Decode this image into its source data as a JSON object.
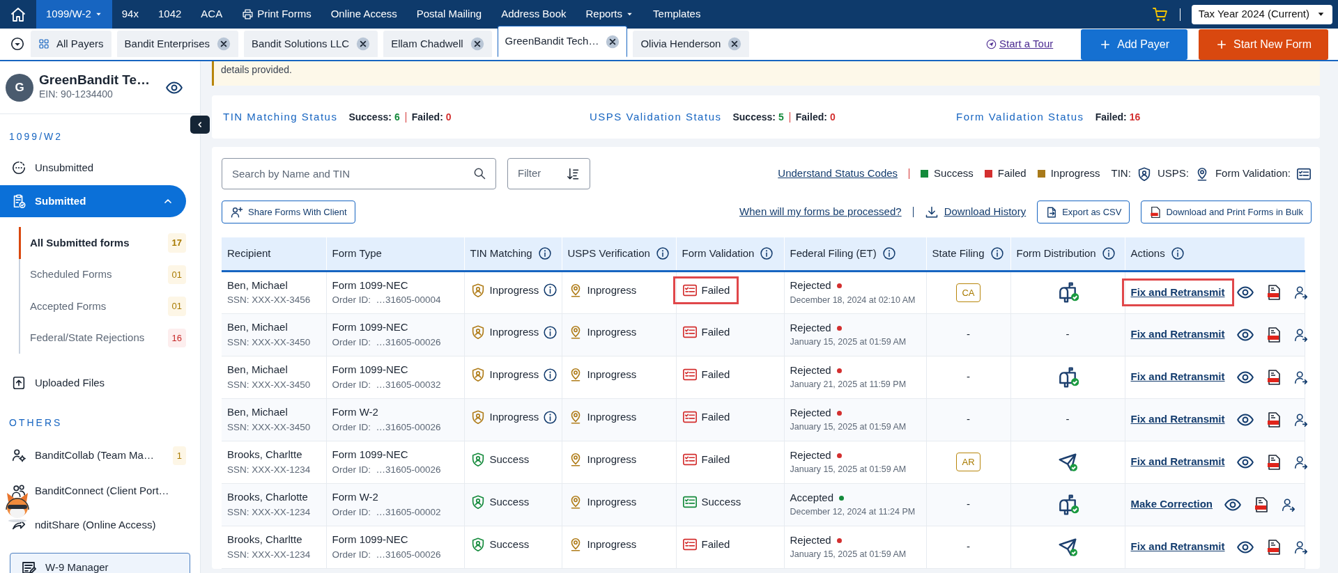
{
  "top_nav": {
    "items": [
      {
        "label": "1099/W-2",
        "selected": true,
        "kind": "dropdown"
      },
      {
        "label": "94x",
        "selected": false,
        "kind": "plain"
      },
      {
        "label": "1042",
        "selected": false,
        "kind": "plain"
      },
      {
        "label": "ACA",
        "selected": false,
        "kind": "plain"
      },
      {
        "label": "Print Forms",
        "selected": false,
        "kind": "print"
      },
      {
        "label": "Online Access",
        "selected": false,
        "kind": "plain"
      },
      {
        "label": "Postal Mailing",
        "selected": false,
        "kind": "plain"
      },
      {
        "label": "Address Book",
        "selected": false,
        "kind": "plain"
      },
      {
        "label": "Reports",
        "selected": false,
        "kind": "dropdown"
      },
      {
        "label": "Templates",
        "selected": false,
        "kind": "plain"
      }
    ],
    "tax_year": "Tax Year 2024 (Current)"
  },
  "payer_bar": {
    "all_label": "All Payers",
    "tabs": [
      {
        "label": "Bandit Enterprises",
        "selected": false
      },
      {
        "label": "Bandit Solutions LLC",
        "selected": false
      },
      {
        "label": "Ellam Chadwell",
        "selected": false
      },
      {
        "label": "GreenBandit Tech…",
        "selected": true
      },
      {
        "label": "Olivia Henderson",
        "selected": false
      }
    ],
    "tour_link": "Start a Tour",
    "add_payer": "Add Payer",
    "start_form": "Start New Form"
  },
  "sidebar": {
    "payer": {
      "initial": "G",
      "name": "GreenBandit Te…",
      "ein": "EIN: 90-1234400"
    },
    "sections": [
      {
        "title": "1099/W2",
        "items": [
          {
            "label": "Unsubmitted",
            "kind": "unsubmitted",
            "selected": false
          },
          {
            "label": "Submitted",
            "kind": "submitted",
            "selected": true,
            "expanded": true,
            "children": [
              {
                "label": "All Submitted forms",
                "count": "17",
                "color": "#a87a00",
                "selected": true
              },
              {
                "label": "Scheduled Forms",
                "count": "01",
                "color": "#a87a00",
                "selected": false
              },
              {
                "label": "Accepted Forms",
                "count": "01",
                "color": "#a87a00",
                "selected": false
              },
              {
                "label": "Federal/State Rejections",
                "count": "16",
                "color": "#c62828",
                "selected": false
              }
            ]
          },
          {
            "label": "Uploaded Files",
            "kind": "upload",
            "selected": false
          }
        ]
      },
      {
        "title": "OTHERS",
        "items": [
          {
            "label": "BanditCollab (Team Ma…",
            "kind": "team",
            "count": "1",
            "color": "#a87a00",
            "selected": false
          },
          {
            "label": "BanditConnect (Client Port…",
            "kind": "connect",
            "selected": false
          },
          {
            "label": "nditShare (Online Access)",
            "kind": "share",
            "selected": false
          }
        ]
      }
    ],
    "w9_button": "W-9 Manager"
  },
  "banner": {
    "text": "details provided."
  },
  "status_summary": [
    {
      "title": "TIN Matching Status",
      "parts": [
        {
          "label": "Success:",
          "value": "6",
          "kind": "success"
        },
        {
          "label": "Failed:",
          "value": "0",
          "kind": "failed"
        }
      ]
    },
    {
      "title": "USPS Validation Status",
      "parts": [
        {
          "label": "Success:",
          "value": "5",
          "kind": "success"
        },
        {
          "label": "Failed:",
          "value": "0",
          "kind": "failed"
        }
      ]
    },
    {
      "title": "Form Validation Status",
      "parts": [
        {
          "label": "Failed:",
          "value": "16",
          "kind": "failed"
        }
      ]
    }
  ],
  "toolbar": {
    "search": {
      "placeholder": "Search by Name and TIN"
    },
    "filter": "Filter",
    "status_codes_link": "Understand Status Codes",
    "legend": [
      {
        "label": "Success",
        "color": "#148a3b"
      },
      {
        "label": "Failed",
        "color": "#d32f2f"
      },
      {
        "label": "Inprogress",
        "color": "#a87a1a"
      }
    ],
    "legend_icons": [
      {
        "label": "TIN:",
        "kind": "tin"
      },
      {
        "label": "USPS:",
        "kind": "usps"
      },
      {
        "label": "Form Validation:",
        "kind": "validation"
      }
    ],
    "share_button": "Share Forms With Client",
    "processed_link": "When will my forms be processed?",
    "download_history": "Download History",
    "export_csv": "Export as CSV",
    "bulk_download": "Download and Print Forms in Bulk"
  },
  "table": {
    "columns": [
      {
        "label": "Recipient"
      },
      {
        "label": "Form Type"
      },
      {
        "label": "TIN Matching",
        "info": true
      },
      {
        "label": "USPS Verification",
        "info": true
      },
      {
        "label": "Form Validation",
        "info": true
      },
      {
        "label": "Federal Filing (ET)",
        "info": true
      },
      {
        "label": "State Filing",
        "info": true
      },
      {
        "label": "Form Distribution",
        "info": true
      },
      {
        "label": "Actions",
        "info": true
      }
    ],
    "rows": [
      {
        "recipient": "Ben, Michael",
        "ssn": "SSN: XXX-XX-3456",
        "form_type": "Form 1099-NEC",
        "order_id": "Order ID:  …31605-00004",
        "tin": {
          "status": "Inprogress",
          "kind": "inprogress",
          "info": true
        },
        "usps": {
          "status": "Inprogress",
          "kind": "inprogress"
        },
        "validation": {
          "status": "Failed",
          "kind": "failed",
          "highlighted": true
        },
        "federal": {
          "status": "Rejected",
          "color": "#d32f2f",
          "date": "December 18, 2024 at 02:10 AM"
        },
        "state": {
          "text": "CA",
          "kind": "badge"
        },
        "distribution": {
          "kind": "mail"
        },
        "action": {
          "label": "Fix and Retransmit",
          "highlighted": true
        }
      },
      {
        "recipient": "Ben, Michael",
        "ssn": "SSN: XXX-XX-3450",
        "form_type": "Form 1099-NEC",
        "order_id": "Order ID:  …31605-00026",
        "tin": {
          "status": "Inprogress",
          "kind": "inprogress",
          "info": true
        },
        "usps": {
          "status": "Inprogress",
          "kind": "inprogress"
        },
        "validation": {
          "status": "Failed",
          "kind": "failed"
        },
        "federal": {
          "status": "Rejected",
          "color": "#d32f2f",
          "date": "January 15, 2025 at 01:59 AM"
        },
        "state": {
          "text": "-",
          "kind": "none"
        },
        "distribution": {
          "kind": "none",
          "text": "-"
        },
        "action": {
          "label": "Fix and Retransmit"
        }
      },
      {
        "recipient": "Ben, Michael",
        "ssn": "SSN: XXX-XX-3450",
        "form_type": "Form 1099-NEC",
        "order_id": "Order ID:  …31605-00032",
        "tin": {
          "status": "Inprogress",
          "kind": "inprogress",
          "info": true
        },
        "usps": {
          "status": "Inprogress",
          "kind": "inprogress"
        },
        "validation": {
          "status": "Failed",
          "kind": "failed"
        },
        "federal": {
          "status": "Rejected",
          "color": "#d32f2f",
          "date": "January 21, 2025 at 11:59 PM"
        },
        "state": {
          "text": "-",
          "kind": "none"
        },
        "distribution": {
          "kind": "mail"
        },
        "action": {
          "label": "Fix and Retransmit"
        }
      },
      {
        "recipient": "Ben, Michael",
        "ssn": "SSN: XXX-XX-3450",
        "form_type": "Form W-2",
        "order_id": "Order ID:  …31605-00026",
        "tin": {
          "status": "Inprogress",
          "kind": "inprogress",
          "info": true
        },
        "usps": {
          "status": "Inprogress",
          "kind": "inprogress"
        },
        "validation": {
          "status": "Failed",
          "kind": "failed"
        },
        "federal": {
          "status": "Rejected",
          "color": "#d32f2f",
          "date": "January 15, 2025 at 01:59 AM"
        },
        "state": {
          "text": "-",
          "kind": "none"
        },
        "distribution": {
          "kind": "none",
          "text": "-"
        },
        "action": {
          "label": "Fix and Retransmit"
        }
      },
      {
        "recipient": "Brooks, Charltte",
        "ssn": "SSN: XXX-XX-1234",
        "form_type": "Form 1099-NEC",
        "order_id": "Order ID:  …31605-00026",
        "tin": {
          "status": "Success",
          "kind": "success"
        },
        "usps": {
          "status": "Inprogress",
          "kind": "inprogress"
        },
        "validation": {
          "status": "Failed",
          "kind": "failed"
        },
        "federal": {
          "status": "Rejected",
          "color": "#d32f2f",
          "date": "January 15, 2025 at 01:59 AM"
        },
        "state": {
          "text": "AR",
          "kind": "badge"
        },
        "distribution": {
          "kind": "online"
        },
        "action": {
          "label": "Fix and Retransmit"
        }
      },
      {
        "recipient": "Brooks, Charlotte",
        "ssn": "SSN: XXX-XX-1234",
        "form_type": "Form W-2",
        "order_id": "Order ID:  …31605-00002",
        "tin": {
          "status": "Success",
          "kind": "success"
        },
        "usps": {
          "status": "Inprogress",
          "kind": "inprogress"
        },
        "validation": {
          "status": "Success",
          "kind": "success"
        },
        "federal": {
          "status": "Accepted",
          "color": "#148a3b",
          "date": "December 12, 2024 at 11:24 PM"
        },
        "state": {
          "text": "-",
          "kind": "none"
        },
        "distribution": {
          "kind": "mail"
        },
        "action": {
          "label": "Make Correction"
        }
      },
      {
        "recipient": "Brooks, Charltte",
        "ssn": "SSN: XXX-XX-1234",
        "form_type": "Form 1099-NEC",
        "order_id": "Order ID:  …31605-00026",
        "tin": {
          "status": "Success",
          "kind": "success"
        },
        "usps": {
          "status": "Inprogress",
          "kind": "inprogress"
        },
        "validation": {
          "status": "Failed",
          "kind": "failed"
        },
        "federal": {
          "status": "Rejected",
          "color": "#d32f2f",
          "date": "January 15, 2025 at 01:59 AM"
        },
        "state": {
          "text": "-",
          "kind": "none"
        },
        "distribution": {
          "kind": "online"
        },
        "action": {
          "label": "Fix and Retransmit"
        }
      }
    ]
  }
}
